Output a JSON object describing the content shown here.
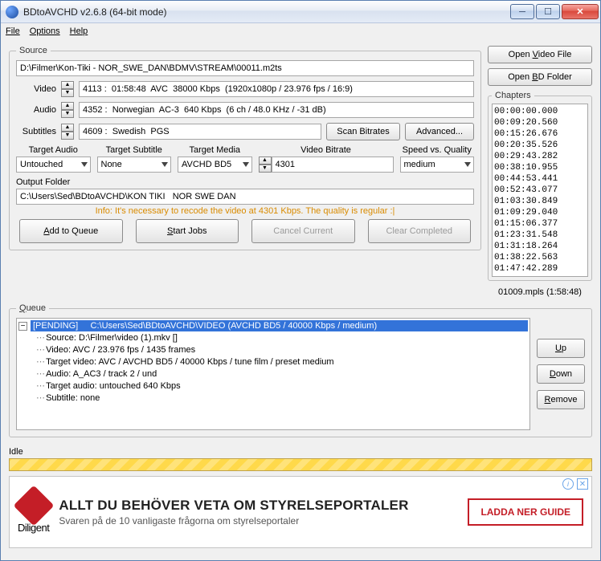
{
  "window": {
    "title": "BDtoAVCHD v2.6.8   (64-bit mode)"
  },
  "menu": {
    "file": "File",
    "options": "Options",
    "help": "Help"
  },
  "buttons": {
    "open_video": "Open Video File",
    "open_bd": "Open BD Folder",
    "scan_bitrates": "Scan Bitrates",
    "advanced": "Advanced...",
    "add_queue": "Add to Queue",
    "start_jobs": "Start Jobs",
    "cancel_current": "Cancel Current",
    "clear_completed": "Clear Completed",
    "up": "Up",
    "down": "Down",
    "remove": "Remove",
    "ad_cta": "LADDA NER GUIDE"
  },
  "labels": {
    "source": "Source",
    "video": "Video",
    "audio": "Audio",
    "subtitles": "Subtitles",
    "target_audio": "Target Audio",
    "target_subtitle": "Target Subtitle",
    "target_media": "Target Media",
    "video_bitrate": "Video Bitrate",
    "speed_quality": "Speed vs. Quality",
    "output_folder": "Output Folder",
    "queue": "Queue",
    "chapters": "Chapters",
    "idle": "Idle"
  },
  "source": {
    "path": "D:\\Filmer\\Kon-Tiki - NOR_SWE_DAN\\BDMV\\STREAM\\00011.m2ts",
    "video": "4113 :  01:58:48  AVC  38000 Kbps  (1920x1080p / 23.976 fps / 16:9)",
    "audio": "4352 :  Norwegian  AC-3  640 Kbps  (6 ch / 48.0 KHz / -31 dB)",
    "subtitles": "4609 :  Swedish  PGS"
  },
  "targets": {
    "audio": "Untouched",
    "subtitle": "None",
    "media": "AVCHD BD5",
    "bitrate": "4301",
    "speed": "medium"
  },
  "output_folder": "C:\\Users\\Sed\\BDtoAVCHD\\KON TIKI   NOR SWE DAN",
  "info_line": "Info: It's necessary to recode the video at 4301 Kbps. The quality is regular :|",
  "chapters": {
    "items": [
      "00:00:00.000",
      "00:09:20.560",
      "00:15:26.676",
      "00:20:35.526",
      "00:29:43.282",
      "00:38:10.955",
      "00:44:53.441",
      "00:52:43.077",
      "01:03:30.849",
      "01:09:29.040",
      "01:15:06.377",
      "01:23:31.548",
      "01:31:18.264",
      "01:38:22.563",
      "01:47:42.289"
    ],
    "mpls": "01009.mpls (1:58:48)"
  },
  "queue": {
    "header": "[PENDING]     C:\\Users\\Sed\\BDtoAVCHD\\VIDEO (AVCHD BD5 / 40000 Kbps / medium)",
    "lines": [
      "Source: D:\\Filmer\\video (1).mkv []",
      "Video: AVC / 23.976 fps / 1435 frames",
      "Target video: AVC / AVCHD BD5 / 40000 Kbps / tune film / preset medium",
      "Audio: A_AC3 / track 2 / und",
      "Target audio: untouched 640 Kbps",
      "Subtitle: none"
    ]
  },
  "ad": {
    "brand": "Diligent",
    "headline": "ALLT DU BEHÖVER VETA OM STYRELSEPORTALER",
    "sub": "Svaren på de 10 vanligaste frågorna om styrelseportaler"
  }
}
